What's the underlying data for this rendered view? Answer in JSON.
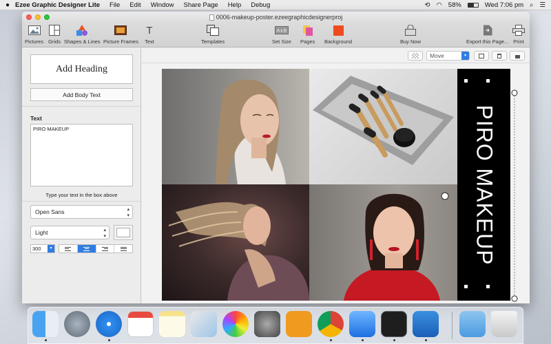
{
  "menubar": {
    "app_name": "Ezee Graphic Designer Lite",
    "menus": [
      "File",
      "Edit",
      "Window",
      "Share Page",
      "Help",
      "Debug"
    ],
    "battery": "58%",
    "clock": "Wed 7:06 pm"
  },
  "window": {
    "title": "0006-makeup-poster.ezeegraphicdesignerproj"
  },
  "toolbar": {
    "pictures": "Pictures",
    "grids": "Grids",
    "shapes": "Shapes & Lines",
    "frames": "Picture Frames",
    "text": "Text",
    "templates": "Templates",
    "set_size": "Set Size",
    "pages": "Pages",
    "background": "Background",
    "buy_now": "Buy Now",
    "export": "Export this Page...",
    "print": "Print"
  },
  "subbar": {
    "mode": "Move"
  },
  "leftpanel": {
    "add_heading": "Add Heading",
    "add_body_text": "Add Body Text",
    "text_label": "Text",
    "text_value": "PIRO MAKEUP",
    "hint": "Type your text in the box above",
    "font": "Open Sans",
    "weight": "Light",
    "size": "300"
  },
  "poster": {
    "title": "PIRO MAKEUP"
  },
  "colors": {
    "accent": "#2f7de1",
    "strip": "#000000"
  }
}
